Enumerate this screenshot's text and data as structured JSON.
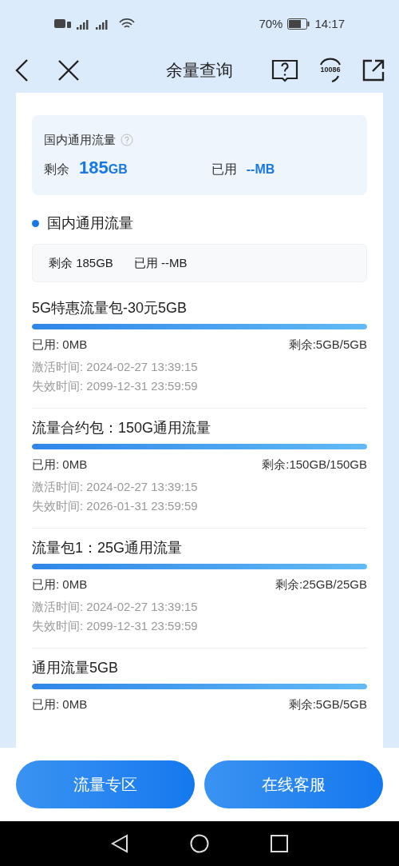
{
  "status_bar": {
    "battery": "70%",
    "time": "14:17"
  },
  "nav": {
    "title": "余量查询",
    "service_number": "10086"
  },
  "summary": {
    "title": "国内通用流量",
    "remaining_label": "剩余",
    "remaining_value": "185",
    "remaining_unit": "GB",
    "used_label": "已用",
    "used_value": "--",
    "used_unit": "MB"
  },
  "section": {
    "title": "国内通用流量",
    "remaining": "剩余 185GB",
    "used": "已用 --MB"
  },
  "packages": [
    {
      "name": "5G特惠流量包-30元5GB",
      "level": 1,
      "used": "已用: 0MB",
      "remaining": "剩余:5GB/5GB",
      "activated": "激活时间: 2024-02-27 13:39:15",
      "expires": "失效时间: 2099-12-31 23:59:59"
    },
    {
      "name": "流量合约包：150G通用流量",
      "level": 1,
      "used": "已用: 0MB",
      "remaining": "剩余:150GB/150GB",
      "activated": "激活时间: 2024-02-27 13:39:15",
      "expires": "失效时间: 2026-01-31 23:59:59"
    },
    {
      "name": "流量包1：25G通用流量",
      "level": 1,
      "used": "已用: 0MB",
      "remaining": "剩余:25GB/25GB",
      "activated": "激活时间: 2024-02-27 13:39:15",
      "expires": "失效时间: 2099-12-31 23:59:59"
    },
    {
      "name": "通用流量5GB",
      "level": 1,
      "used": "已用: 0MB",
      "remaining": "剩余:5GB/5GB"
    }
  ],
  "buttons": [
    "流量专区",
    "在线客服"
  ]
}
